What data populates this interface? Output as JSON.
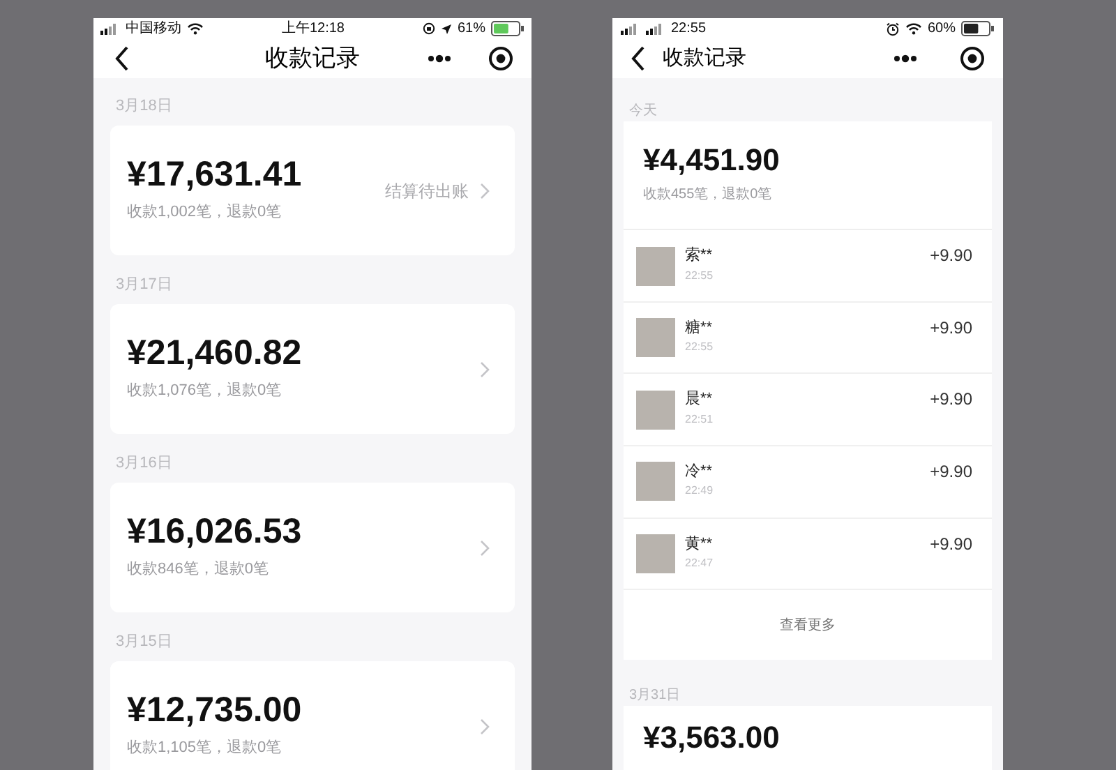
{
  "left_phone": {
    "status_bar": {
      "carrier": "中国移动",
      "time": "上午12:18",
      "battery": "61%"
    },
    "nav": {
      "title": "收款记录"
    },
    "days": [
      {
        "date": "3月18日",
        "amount": "¥17,631.41",
        "summary": "收款1,002笔，退款0笔",
        "note": "结算待出账"
      },
      {
        "date": "3月17日",
        "amount": "¥21,460.82",
        "summary": "收款1,076笔，退款0笔"
      },
      {
        "date": "3月16日",
        "amount": "¥16,026.53",
        "summary": "收款846笔，退款0笔"
      },
      {
        "date": "3月15日",
        "amount": "¥12,735.00",
        "summary": "收款1,105笔，退款0笔"
      }
    ]
  },
  "right_phone": {
    "status_bar": {
      "time": "22:55",
      "battery": "60%"
    },
    "nav": {
      "title": "收款记录"
    },
    "today": {
      "label": "今天",
      "amount": "¥4,451.90",
      "summary": "收款455笔，退款0笔",
      "payments": [
        {
          "name": "索**",
          "time": "22:55",
          "amount": "+9.90"
        },
        {
          "name": "糖**",
          "time": "22:55",
          "amount": "+9.90"
        },
        {
          "name": "晨**",
          "time": "22:51",
          "amount": "+9.90"
        },
        {
          "name": "冷**",
          "time": "22:49",
          "amount": "+9.90"
        },
        {
          "name": "黄**",
          "time": "22:47",
          "amount": "+9.90"
        }
      ],
      "more": "查看更多"
    },
    "next_day": {
      "date": "3月31日",
      "amount": "¥3,563.00"
    }
  }
}
